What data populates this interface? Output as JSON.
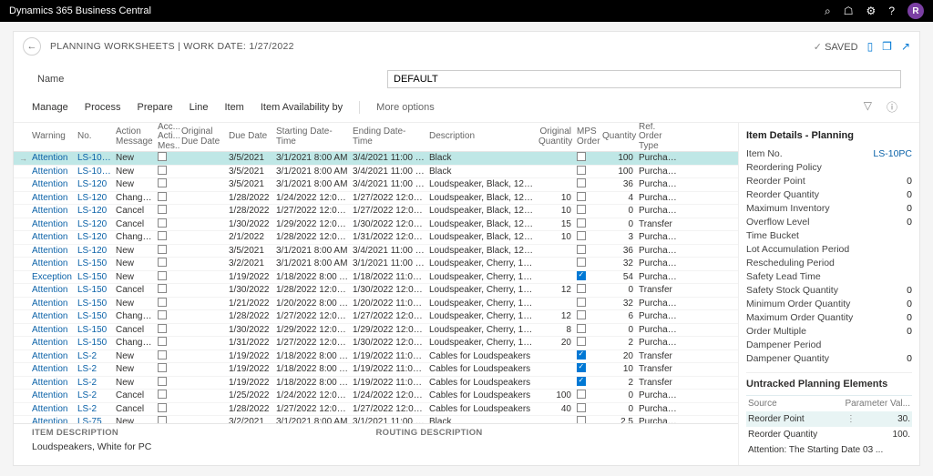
{
  "app_title": "Dynamics 365 Business Central",
  "avatar_initial": "R",
  "breadcrumb": "PLANNING WORKSHEETS | WORK DATE: 1/27/2022",
  "saved_label": "SAVED",
  "name_label": "Name",
  "name_value": "DEFAULT",
  "toolbar": [
    "Manage",
    "Process",
    "Prepare",
    "Line",
    "Item",
    "Item Availability by"
  ],
  "toolbar_more": "More options",
  "columns": [
    "",
    "Warning",
    "No.",
    "Action Message",
    "Acc... Acti... Mes...",
    "Original Due Date",
    "Due Date",
    "Starting Date-Time",
    "Ending Date-Time",
    "Description",
    "Original Quantity",
    "MPS Order",
    "Quantity",
    "Ref. Order Type"
  ],
  "rows": [
    {
      "sel": true,
      "warn": "Attention",
      "no": "LS-10PC",
      "act": "New",
      "acc": false,
      "odd": "",
      "due": "3/5/2021",
      "sdt": "3/1/2021 8:00 AM",
      "edt": "3/4/2021 11:00 PM",
      "desc": "Black",
      "oq": "",
      "mps": false,
      "qty": "100",
      "rot": "Purchase"
    },
    {
      "warn": "Attention",
      "no": "LS-10PC",
      "act": "New",
      "acc": false,
      "odd": "",
      "due": "3/5/2021",
      "sdt": "3/1/2021 8:00 AM",
      "edt": "3/4/2021 11:00 PM",
      "desc": "Black",
      "oq": "",
      "mps": false,
      "qty": "100",
      "rot": "Purchase"
    },
    {
      "warn": "Attention",
      "no": "LS-120",
      "act": "New",
      "acc": false,
      "odd": "",
      "due": "3/5/2021",
      "sdt": "3/1/2021 8:00 AM",
      "edt": "3/4/2021 11:00 PM",
      "desc": "Loudspeaker, Black, 120W",
      "oq": "",
      "mps": false,
      "qty": "36",
      "rot": "Purchase"
    },
    {
      "warn": "Attention",
      "no": "LS-120",
      "act": "Change Qty.",
      "acc": false,
      "odd": "",
      "due": "1/28/2022",
      "sdt": "1/24/2022 12:00 ...",
      "edt": "1/27/2022 12:00 ...",
      "desc": "Loudspeaker, Black, 120W",
      "oq": "10",
      "mps": false,
      "qty": "4",
      "rot": "Purchase"
    },
    {
      "warn": "Attention",
      "no": "LS-120",
      "act": "Cancel",
      "acc": false,
      "odd": "",
      "due": "1/28/2022",
      "sdt": "1/27/2022 12:00 ...",
      "edt": "1/27/2022 12:00 ...",
      "desc": "Loudspeaker, Black, 120W",
      "oq": "10",
      "mps": false,
      "qty": "0",
      "rot": "Purchase"
    },
    {
      "warn": "Attention",
      "no": "LS-120",
      "act": "Cancel",
      "acc": false,
      "odd": "",
      "due": "1/30/2022",
      "sdt": "1/29/2022 12:00 ...",
      "edt": "1/30/2022 12:00 ...",
      "desc": "Loudspeaker, Black, 120W",
      "oq": "15",
      "mps": false,
      "qty": "0",
      "rot": "Transfer"
    },
    {
      "warn": "Attention",
      "no": "LS-120",
      "act": "Change Qty.",
      "acc": false,
      "odd": "",
      "due": "2/1/2022",
      "sdt": "1/28/2022 12:00 ...",
      "edt": "1/31/2022 12:00 ...",
      "desc": "Loudspeaker, Black, 120W",
      "oq": "10",
      "mps": false,
      "qty": "3",
      "rot": "Purchase"
    },
    {
      "warn": "Attention",
      "no": "LS-120",
      "act": "New",
      "acc": false,
      "odd": "",
      "due": "3/5/2021",
      "sdt": "3/1/2021 8:00 AM",
      "edt": "3/4/2021 11:00 PM",
      "desc": "Loudspeaker, Black, 120W",
      "oq": "",
      "mps": false,
      "qty": "36",
      "rot": "Purchase"
    },
    {
      "warn": "Attention",
      "no": "LS-150",
      "act": "New",
      "acc": false,
      "odd": "",
      "due": "3/2/2021",
      "sdt": "3/1/2021 8:00 AM",
      "edt": "3/1/2021 11:00 PM",
      "desc": "Loudspeaker, Cherry, 150W",
      "oq": "",
      "mps": false,
      "qty": "32",
      "rot": "Purchase"
    },
    {
      "warn": "Exception",
      "no": "LS-150",
      "act": "New",
      "acc": false,
      "odd": "",
      "due": "1/19/2022",
      "sdt": "1/18/2022 8:00 AM",
      "edt": "1/18/2022 11:00 PM",
      "desc": "Loudspeaker, Cherry, 150W",
      "oq": "",
      "mps": true,
      "qty": "54",
      "rot": "Purchase"
    },
    {
      "warn": "Attention",
      "no": "LS-150",
      "act": "Cancel",
      "acc": false,
      "odd": "",
      "due": "1/30/2022",
      "sdt": "1/28/2022 12:00 ...",
      "edt": "1/30/2022 12:00 ...",
      "desc": "Loudspeaker, Cherry, 150W",
      "oq": "12",
      "mps": false,
      "qty": "0",
      "rot": "Transfer"
    },
    {
      "warn": "Attention",
      "no": "LS-150",
      "act": "New",
      "acc": false,
      "odd": "",
      "due": "1/21/2022",
      "sdt": "1/20/2022 8:00 AM",
      "edt": "1/20/2022 11:00 PM",
      "desc": "Loudspeaker, Cherry, 150W",
      "oq": "",
      "mps": false,
      "qty": "32",
      "rot": "Purchase"
    },
    {
      "warn": "Attention",
      "no": "LS-150",
      "act": "Change Qty.",
      "acc": false,
      "odd": "",
      "due": "1/28/2022",
      "sdt": "1/27/2022 12:00 ...",
      "edt": "1/27/2022 12:00 ...",
      "desc": "Loudspeaker, Cherry, 150W",
      "oq": "12",
      "mps": false,
      "qty": "6",
      "rot": "Purchase"
    },
    {
      "warn": "Attention",
      "no": "LS-150",
      "act": "Cancel",
      "acc": false,
      "odd": "",
      "due": "1/30/2022",
      "sdt": "1/29/2022 12:00 ...",
      "edt": "1/29/2022 12:00 ...",
      "desc": "Loudspeaker, Cherry, 150W",
      "oq": "8",
      "mps": false,
      "qty": "0",
      "rot": "Purchase"
    },
    {
      "warn": "Attention",
      "no": "LS-150",
      "act": "Change Qty.",
      "acc": false,
      "odd": "",
      "due": "1/31/2022",
      "sdt": "1/27/2022 12:00 ...",
      "edt": "1/30/2022 12:00 ...",
      "desc": "Loudspeaker, Cherry, 150W",
      "oq": "20",
      "mps": false,
      "qty": "2",
      "rot": "Purchase"
    },
    {
      "warn": "Attention",
      "no": "LS-2",
      "act": "New",
      "acc": false,
      "odd": "",
      "due": "1/19/2022",
      "sdt": "1/18/2022 8:00 AM",
      "edt": "1/19/2022 11:00 PM",
      "desc": "Cables for Loudspeakers",
      "oq": "",
      "mps": true,
      "qty": "20",
      "rot": "Transfer"
    },
    {
      "warn": "Attention",
      "no": "LS-2",
      "act": "New",
      "acc": false,
      "odd": "",
      "due": "1/19/2022",
      "sdt": "1/18/2022 8:00 AM",
      "edt": "1/19/2022 11:00 PM",
      "desc": "Cables for Loudspeakers",
      "oq": "",
      "mps": true,
      "qty": "10",
      "rot": "Transfer"
    },
    {
      "warn": "Attention",
      "no": "LS-2",
      "act": "New",
      "acc": false,
      "odd": "",
      "due": "1/19/2022",
      "sdt": "1/18/2022 8:00 AM",
      "edt": "1/19/2022 11:00 PM",
      "desc": "Cables for Loudspeakers",
      "oq": "",
      "mps": true,
      "qty": "2",
      "rot": "Transfer"
    },
    {
      "warn": "Attention",
      "no": "LS-2",
      "act": "Cancel",
      "acc": false,
      "odd": "",
      "due": "1/25/2022",
      "sdt": "1/24/2022 12:00 ...",
      "edt": "1/24/2022 12:00 ...",
      "desc": "Cables for Loudspeakers",
      "oq": "100",
      "mps": false,
      "qty": "0",
      "rot": "Purchase"
    },
    {
      "warn": "Attention",
      "no": "LS-2",
      "act": "Cancel",
      "acc": false,
      "odd": "",
      "due": "1/28/2022",
      "sdt": "1/27/2022 12:00 ...",
      "edt": "1/27/2022 12:00 ...",
      "desc": "Cables for Loudspeakers",
      "oq": "40",
      "mps": false,
      "qty": "0",
      "rot": "Purchase"
    },
    {
      "warn": "Attention",
      "no": "LS-75",
      "act": "New",
      "acc": false,
      "odd": "",
      "due": "3/2/2021",
      "sdt": "3/1/2021 8:00 AM",
      "edt": "3/1/2021 11:00 PM",
      "desc": "Black",
      "oq": "",
      "mps": false,
      "qty": "2.5",
      "rot": "Purchase"
    }
  ],
  "footer": {
    "item_desc_label": "ITEM DESCRIPTION",
    "item_desc_value": "Loudspeakers, White for PC",
    "routing_label": "ROUTING DESCRIPTION",
    "routing_value": ""
  },
  "side": {
    "title": "Item Details - Planning",
    "item_no_label": "Item No.",
    "item_no": "LS-10PC",
    "fields": [
      {
        "l": "Reordering Policy",
        "v": ""
      },
      {
        "l": "Reorder Point",
        "v": "0"
      },
      {
        "l": "Reorder Quantity",
        "v": "0"
      },
      {
        "l": "Maximum Inventory",
        "v": "0"
      },
      {
        "l": "Overflow Level",
        "v": "0"
      },
      {
        "l": "Time Bucket",
        "v": ""
      },
      {
        "l": "Lot Accumulation Period",
        "v": ""
      },
      {
        "l": "Rescheduling Period",
        "v": ""
      },
      {
        "l": "Safety Lead Time",
        "v": ""
      },
      {
        "l": "Safety Stock Quantity",
        "v": "0"
      },
      {
        "l": "Minimum Order Quantity",
        "v": "0"
      },
      {
        "l": "Maximum Order Quantity",
        "v": "0"
      },
      {
        "l": "Order Multiple",
        "v": "0"
      },
      {
        "l": "Dampener Period",
        "v": ""
      },
      {
        "l": "Dampener Quantity",
        "v": "0"
      }
    ],
    "untracked_title": "Untracked Planning Elements",
    "untracked_head": {
      "l": "Source",
      "r": "Parameter Val..."
    },
    "untracked": [
      {
        "l": "Reorder Point",
        "v": "30.",
        "hl": true
      },
      {
        "l": "Reorder Quantity",
        "v": "100.",
        "hl": false
      },
      {
        "l": "Attention: The Starting Date 03 ...",
        "v": "",
        "hl": false
      }
    ]
  }
}
